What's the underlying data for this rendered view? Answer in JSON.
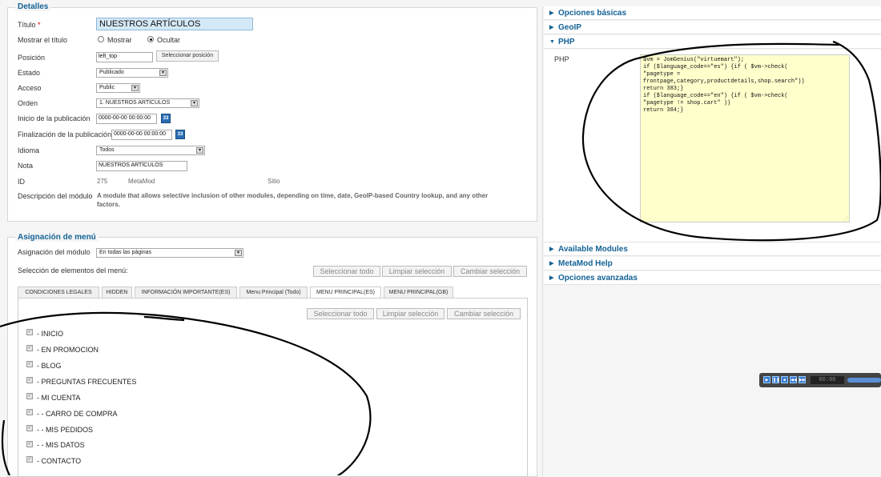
{
  "details": {
    "legend": "Detalles",
    "titulo_label": "Título",
    "required_mark": "*",
    "titulo_value": "NUESTROS ARTÍCULOS",
    "mostrar_titulo_label": "Mostrar el título",
    "mostrar_option": "Mostrar",
    "ocultar_option": "Ocultar",
    "mostrar_selected": "Ocultar",
    "posicion_label": "Posición",
    "posicion_value": "left_top",
    "seleccionar_posicion_button": "Seleccionar posición",
    "estado_label": "Estado",
    "estado_value": "Publicado",
    "acceso_label": "Acceso",
    "acceso_value": "Public",
    "orden_label": "Orden",
    "orden_value": "1. NUESTROS ARTÍCULOS",
    "inicio_label": "Inicio de la publicación",
    "inicio_value": "0000-00-00 00:00:00",
    "fin_label": "Finalización de la publicación",
    "fin_value": "0000-00-00 00:00:00",
    "calendar_icon_text": "33",
    "idioma_label": "Idioma",
    "idioma_value": "Todos",
    "nota_label": "Nota",
    "nota_value": "NUESTROS ARTÍCULOS",
    "id_label": "ID",
    "id_value": "275",
    "module_type": "MetaMod",
    "site_label": "Sitio",
    "descripcion_label": "Descripción del módulo",
    "descripcion_value_line1": "A module that allows selective inclusion of other modules, depending on time, date, GeoIP-based Country lookup, and any other",
    "descripcion_value_line2": "factors."
  },
  "menu_assignment": {
    "legend": "Asignación de menú",
    "asignacion_label": "Asignación del módulo",
    "asignacion_value": "En todas las páginas",
    "seleccion_label": "Selección de elementos del menú:",
    "select_all": "Seleccionar todo",
    "clear_selection": "Limpiar selección",
    "toggle_selection": "Cambiar selección",
    "tabs": [
      {
        "label": "CONDICIONES LEGALES",
        "active": false
      },
      {
        "label": "HIDDEN",
        "active": false
      },
      {
        "label": "INFORMACIÓN IMPORTANTE(ES)",
        "active": false
      },
      {
        "label": "Menu Principal (Todo)",
        "active": false
      },
      {
        "label": "MENU PRINCIPAL(ES)",
        "active": true
      },
      {
        "label": "MENU PRINCIPAL(GB)",
        "active": false
      }
    ],
    "items": [
      {
        "label": "- INICIO",
        "checked": true
      },
      {
        "label": "- EN PROMOCION",
        "checked": true
      },
      {
        "label": "- BLOG",
        "checked": true
      },
      {
        "label": "- PREGUNTAS FRECUENTES",
        "checked": true
      },
      {
        "label": "- MI CUENTA",
        "checked": true
      },
      {
        "label": "- - CARRO DE COMPRA",
        "checked": true
      },
      {
        "label": "- - MIS PEDIDOS",
        "checked": true
      },
      {
        "label": "- - MIS DATOS",
        "checked": true
      },
      {
        "label": "- CONTACTO",
        "checked": true
      }
    ]
  },
  "accordion": {
    "opciones_basicas": "Opciones básicas",
    "geoip": "GeoIP",
    "php": "PHP",
    "available_modules": "Available Modules",
    "metamod_help": "MetaMod Help",
    "opciones_avanzadas": "Opciones avanzadas"
  },
  "php_panel": {
    "label": "PHP",
    "code": "$vm = JomGenius(\"virtuemart\");\nif ($language_code==\"es\") {if ( $vm->check(\n\"pagetype =\nfrontpage,category,productdetails,shop.search\"))\nreturn 383;}\nif ($language_code==\"en\") {if ( $vm->check(\n\"pagetype != shop.cart\" ))\nreturn 384;}"
  },
  "player": {
    "time": "00:00"
  },
  "colors": {
    "accent": "#146295",
    "title_input_bg": "#d4e9f7",
    "code_bg": "#ffffcc",
    "annotation": "#000000"
  }
}
